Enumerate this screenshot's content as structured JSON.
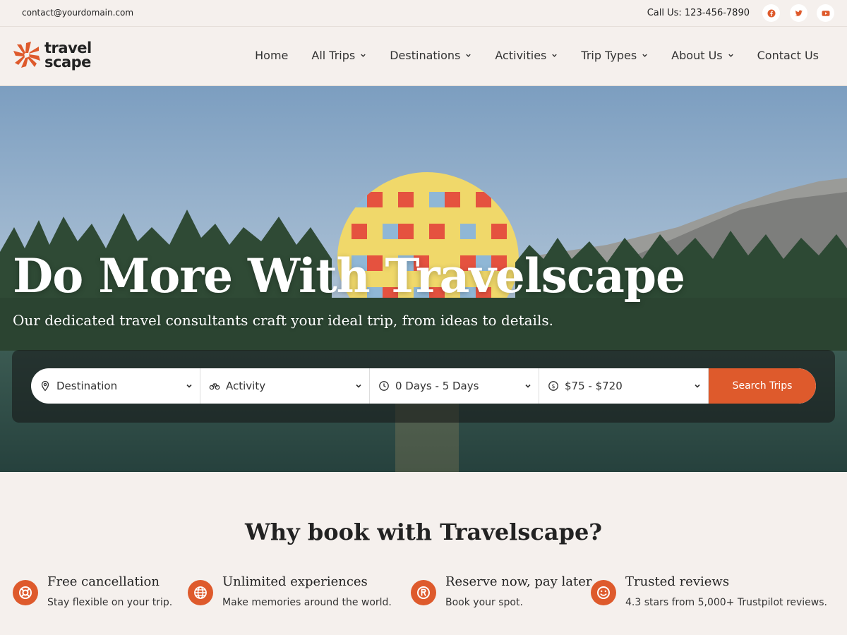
{
  "topbar": {
    "email": "contact@yourdomain.com",
    "phone": "Call Us: 123-456-7890",
    "social": [
      "facebook-icon",
      "twitter-icon",
      "youtube-icon"
    ]
  },
  "brand": {
    "line1": "travel",
    "line2": "scape",
    "accent": "#de5a2c"
  },
  "nav": {
    "items": [
      {
        "label": "Home",
        "dropdown": false
      },
      {
        "label": "All Trips",
        "dropdown": true
      },
      {
        "label": "Destinations",
        "dropdown": true
      },
      {
        "label": "Activities",
        "dropdown": true
      },
      {
        "label": "Trip Types",
        "dropdown": true
      },
      {
        "label": "About Us",
        "dropdown": true
      },
      {
        "label": "Contact Us",
        "dropdown": false
      }
    ]
  },
  "hero": {
    "title": "Do More With Travelscape",
    "subtitle": "Our dedicated travel consultants craft your ideal trip, from ideas to details."
  },
  "search": {
    "destination": "Destination",
    "activity": "Activity",
    "duration": "0 Days - 5 Days",
    "price": "$75 - $720",
    "button": "Search Trips"
  },
  "why": {
    "title": "Why book with Travelscape?",
    "features": [
      {
        "icon": "lifebuoy-icon",
        "title": "Free cancellation",
        "desc": "Stay flexible on your trip."
      },
      {
        "icon": "globe-icon",
        "title": "Unlimited experiences",
        "desc": "Make memories around the world."
      },
      {
        "icon": "registered-icon",
        "title": "Reserve now, pay later",
        "desc": "Book your spot."
      },
      {
        "icon": "smile-icon",
        "title": "Trusted reviews",
        "desc": "4.3 stars from 5,000+ Trustpilot reviews."
      }
    ]
  }
}
